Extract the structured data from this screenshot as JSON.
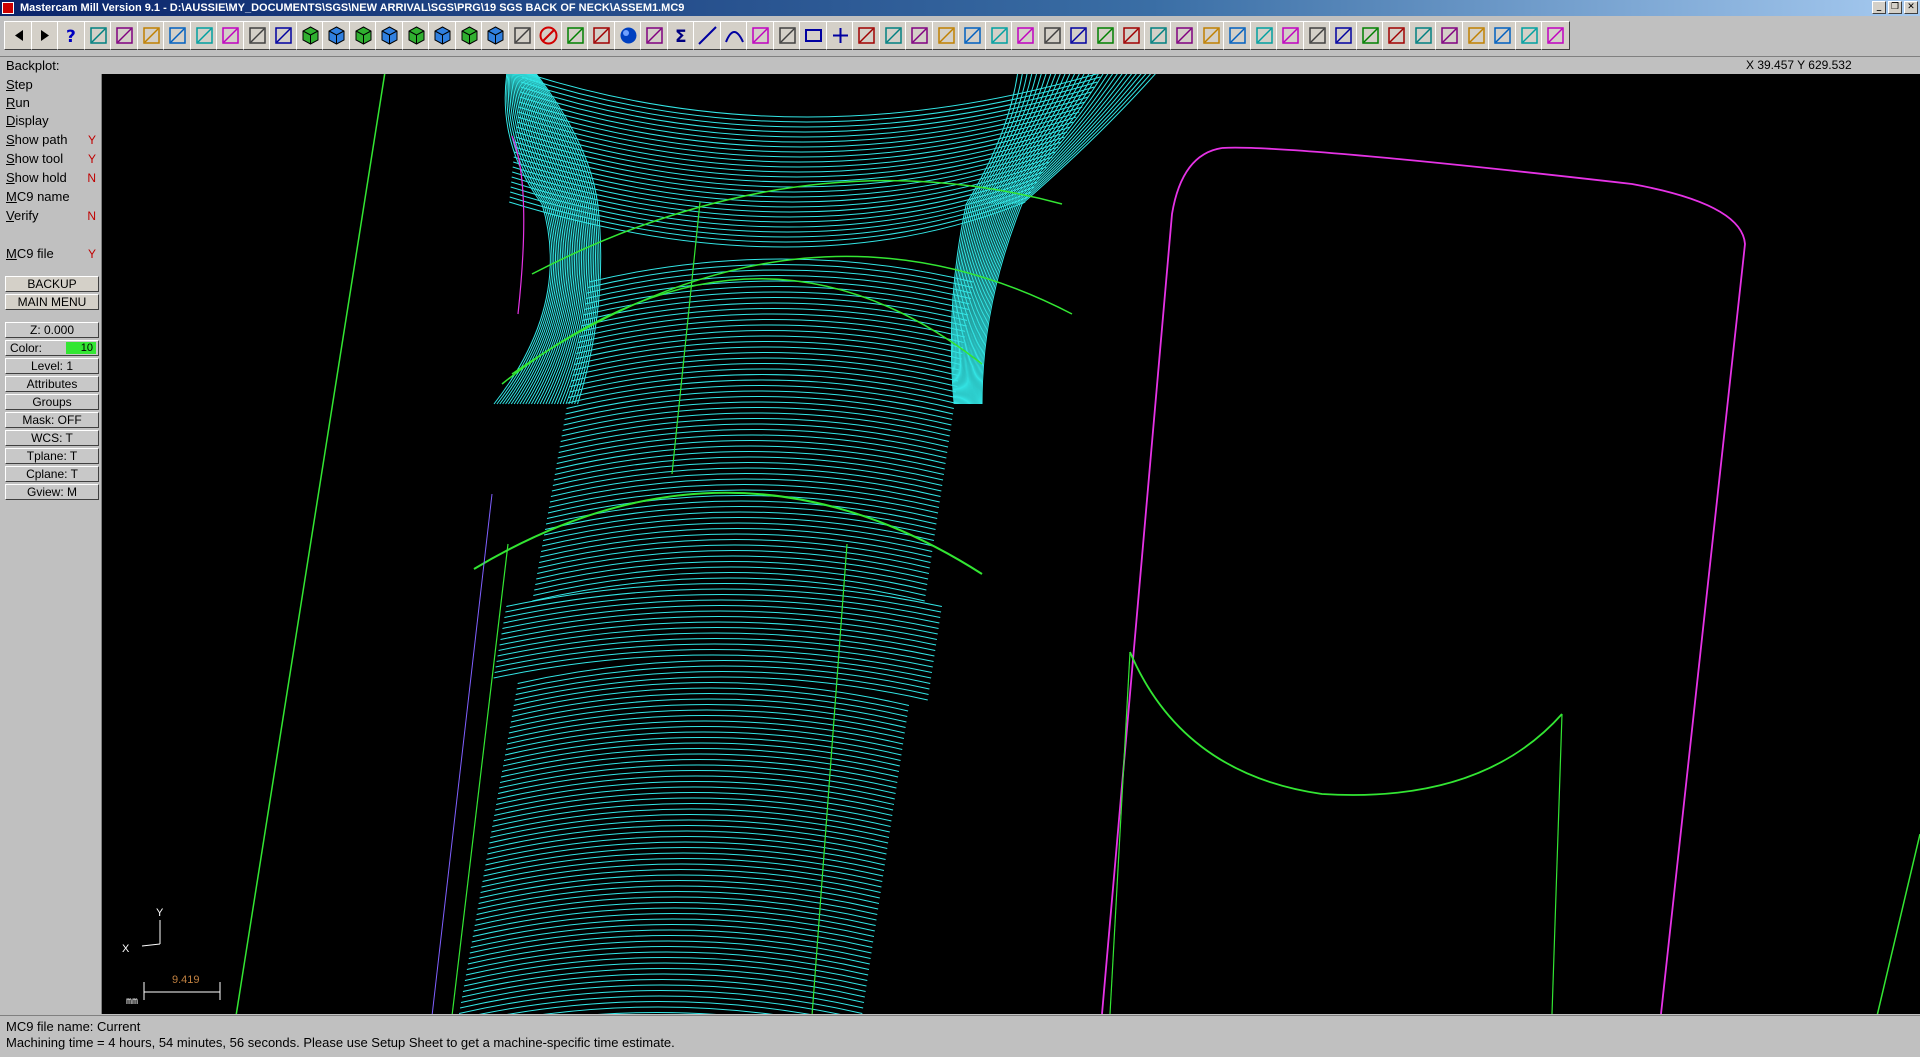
{
  "window": {
    "title": "Mastercam Mill Version 9.1 - D:\\AUSSIE\\MY_DOCUMENTS\\SGS\\NEW ARRIVAL\\SGS\\PRG\\19 SGS BACK OF NECK\\ASSEM1.MC9",
    "minimize_glyph": "_",
    "restore_glyph": "❐",
    "close_glyph": "✕"
  },
  "toolbar": {
    "icons": [
      "back-arrow",
      "forward-arrow",
      "help",
      "open-file",
      "analyze",
      "zoom-window",
      "zoom-out",
      "zoom-previous",
      "pan",
      "select",
      "rotate",
      "view-top",
      "view-front",
      "view-side",
      "view-iso",
      "view-top-alt",
      "view-front-alt",
      "view-side-alt",
      "view-iso-alt",
      "edit-pencil",
      "delete",
      "transform",
      "undo",
      "shade-sphere",
      "group",
      "sum",
      "line",
      "arc",
      "fillet",
      "spline",
      "rectangle",
      "point",
      "surface",
      "solid",
      "chain",
      "trim",
      "break",
      "extend",
      "line-parallel",
      "line-perpendicular",
      "translate",
      "mirror",
      "rotate-transform",
      "scale",
      "offset",
      "divide",
      "draw-box",
      "xyz-origin",
      "ruler",
      "screen-stats",
      "properties",
      "plane-select",
      "tool-manager",
      "stock-setup",
      "verify",
      "backplot",
      "regen",
      "plane-view",
      "nc-output"
    ]
  },
  "backplot": {
    "label": "Backplot:",
    "coords": "X 39.457   Y 629.532"
  },
  "menu": {
    "items": [
      {
        "label": "Step",
        "flag": ""
      },
      {
        "label": "Run",
        "flag": ""
      },
      {
        "label": "Display",
        "flag": ""
      },
      {
        "label": "Show path",
        "flag": "Y"
      },
      {
        "label": "Show tool",
        "flag": "Y"
      },
      {
        "label": "Show hold",
        "flag": "N"
      },
      {
        "label": "MC9 name",
        "flag": ""
      },
      {
        "label": "Verify",
        "flag": "N"
      },
      {
        "label": "MC9 file",
        "flag": "Y"
      }
    ],
    "backup": "BACKUP",
    "main_menu": "MAIN MENU"
  },
  "settings": {
    "z": "Z:   0.000",
    "color_label": "Color:",
    "color_value": "10",
    "level": "Level:   1",
    "attributes": "Attributes",
    "groups": "Groups",
    "mask": "Mask:   OFF",
    "wcs": "WCS:   T",
    "tplane": "Tplane:   T",
    "cplane": "Cplane:   T",
    "gview": "Gview:   M"
  },
  "viewport": {
    "axis_x": "X",
    "axis_y": "Y",
    "scale_value": "9.419",
    "units": "mm",
    "colors": {
      "toolpath": "#33e6e6",
      "geometry": "#33e633",
      "boundary": "#e633e6",
      "background": "#000000"
    }
  },
  "status": {
    "line1": "MC9 file name: Current",
    "line2": "Machining time = 4 hours, 54 minutes, 56 seconds. Please use Setup Sheet to get a machine-specific time estimate."
  }
}
